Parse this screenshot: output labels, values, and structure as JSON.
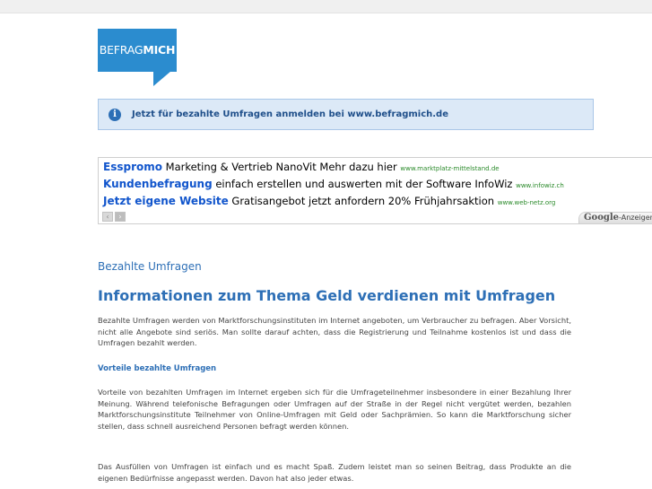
{
  "logo": {
    "light": "BEFRAG",
    "bold": "MICH"
  },
  "info": {
    "icon": "info-icon",
    "glyph": "i",
    "text": "Jetzt für bezahlte Umfragen anmelden bei www.befragmich.de"
  },
  "ads": [
    {
      "title": "Esspromo",
      "text": "Marketing & Vertrieb NanoVit Mehr dazu hier",
      "url": "www.marktplatz-mittelstand.de"
    },
    {
      "title": "Kundenbefragung",
      "text": "einfach erstellen und auswerten mit der Software InfoWiz",
      "url": "www.infowiz.ch"
    },
    {
      "title": "Jetzt eigene Website",
      "text": "Gratisangebot jetzt anfordern 20% Frühjahrsaktion",
      "url": "www.web-netz.org"
    }
  ],
  "ad_nav": {
    "prev": "‹",
    "next": "›"
  },
  "google_badge": {
    "brand": "Google",
    "label": "-Anzeigen"
  },
  "section_label": "Bezahlte Umfragen",
  "headline": "Informationen zum Thema Geld verdienen mit Umfragen",
  "paragraphs": {
    "intro": "Bezahlte Umfragen werden von Marktforschungsinstituten im Internet angeboten, um Verbraucher zu befragen. Aber Vorsicht, nicht alle Angebote sind seriös. Man sollte darauf achten, dass die Registrierung und Teilnahme kostenlos ist und dass die Umfragen bezahlt werden.",
    "subhead": "Vorteile bezahlte Umfragen",
    "advantages": "Vorteile von bezahlten Umfragen im Internet ergeben sich für die Umfrageteilnehmer insbesondere in einer Bezahlung Ihrer Meinung. Während telefonische Befragungen oder Umfragen auf der Straße in der Regel nicht vergütet werden, bezahlen Marktforschungsinstitute Teilnehmer von Online-Umfragen mit Geld oder Sachprämien. So kann die Marktforschung sicher stellen, dass schnell ausreichend Personen befragt werden können.",
    "fun": "Das Ausfüllen von Umfragen ist einfach und es macht Spaß. Zudem leistet man so seinen Beitrag, dass Produkte an die eigenen Bedürfnisse angepasst werden. Davon hat also jeder etwas."
  }
}
